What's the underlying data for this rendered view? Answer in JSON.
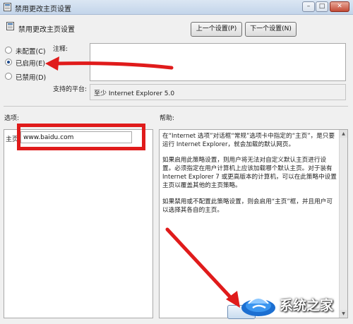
{
  "window": {
    "title": "禁用更改主页设置",
    "caption_buttons": {
      "minimize": "–",
      "maximize": "□",
      "close": "✕"
    }
  },
  "policy": {
    "name": "禁用更改主页设置",
    "prev_button": "上一个设置(P)",
    "next_button": "下一个设置(N)"
  },
  "state": {
    "options": [
      {
        "label": "未配置(C)",
        "checked": false
      },
      {
        "label": "已启用(E)",
        "checked": true
      },
      {
        "label": "已禁用(D)",
        "checked": false
      }
    ]
  },
  "comment": {
    "label": "注释:",
    "value": ""
  },
  "platform": {
    "label": "支持的平台:",
    "value": "至少 Internet Explorer 5.0"
  },
  "options_section": {
    "label": "选项:",
    "home_label": "主页",
    "home_value": "www.baidu.com"
  },
  "help": {
    "label": "帮助:",
    "paragraphs": [
      "在“Internet 选项”对话框“常规”选项卡中指定的“主页”，是只要运行 Internet Explorer，就会加载的默认网页。",
      "如果启用此策略设置，则用户将无法对自定义默认主页进行设置。必须指定在用户计算机上应该加载哪个默认主页。对于装有 Internet Explorer 7 或更高版本的计算机，可以在此策略中设置主页以覆盖其他的主页策略。",
      "如果禁用或不配置此策略设置，则会启用“主页”框，并且用户可以选择其各自的主页。"
    ]
  },
  "watermark": {
    "text": "系统之家"
  },
  "colors": {
    "annotation_red": "#e01b1b",
    "radio_dot": "#1d4a8c"
  }
}
